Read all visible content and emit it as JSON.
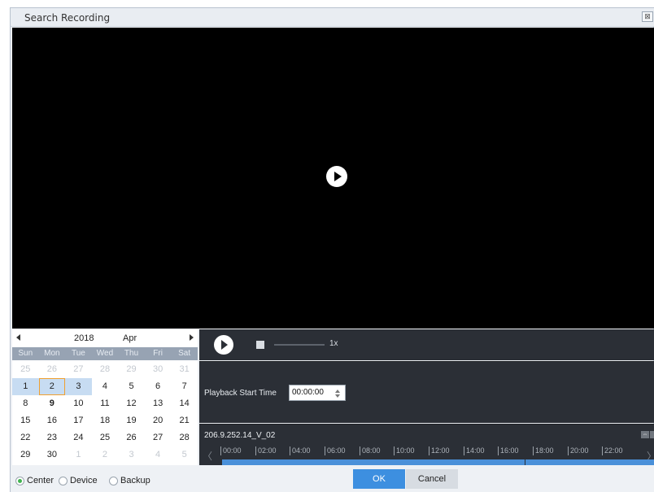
{
  "window": {
    "title": "Search Recording",
    "close_symbol": "⊠"
  },
  "calendar": {
    "year": "2018",
    "month": "Apr",
    "weekdays": [
      "Sun",
      "Mon",
      "Tue",
      "Wed",
      "Thu",
      "Fri",
      "Sat"
    ],
    "weeks": [
      [
        "25",
        "26",
        "27",
        "28",
        "29",
        "30",
        "31"
      ],
      [
        "1",
        "2",
        "3",
        "4",
        "5",
        "6",
        "7"
      ],
      [
        "8",
        "9",
        "10",
        "11",
        "12",
        "13",
        "14"
      ],
      [
        "15",
        "16",
        "17",
        "18",
        "19",
        "20",
        "21"
      ],
      [
        "22",
        "23",
        "24",
        "25",
        "26",
        "27",
        "28"
      ],
      [
        "29",
        "30",
        "1",
        "2",
        "3",
        "4",
        "5"
      ]
    ],
    "selected_day": "2",
    "days_with_recordings": [
      "1",
      "2",
      "3"
    ]
  },
  "playback": {
    "speed": "1x",
    "start_time_label": "Playback Start Time",
    "start_time": "00:00:00"
  },
  "timeline": {
    "channel": "206.9.252.14_V_02",
    "ticks": [
      "00:00",
      "02:00",
      "04:00",
      "06:00",
      "08:00",
      "10:00",
      "12:00",
      "14:00",
      "16:00",
      "18:00",
      "20:00",
      "22:00"
    ]
  },
  "footer": {
    "sources": [
      {
        "label": "Center",
        "selected": true
      },
      {
        "label": "Device",
        "selected": false
      },
      {
        "label": "Backup",
        "selected": false
      }
    ],
    "ok_label": "OK",
    "cancel_label": "Cancel"
  },
  "colors": {
    "accent": "#3d8fe0",
    "recording": "#4a90d9",
    "selected_border": "#f0a030",
    "radio_on": "#3fb34f"
  }
}
